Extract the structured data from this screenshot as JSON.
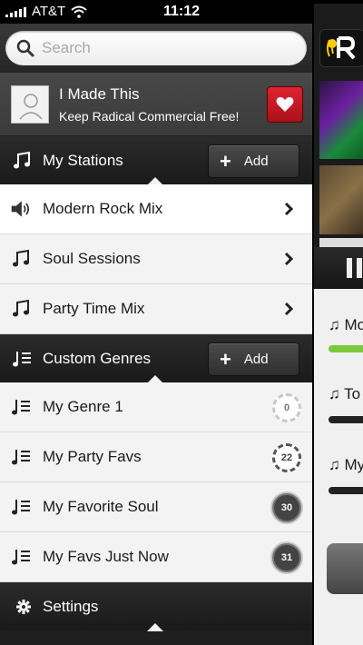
{
  "status_bar": {
    "carrier": "AT&T",
    "time": "11:12"
  },
  "search": {
    "placeholder": "Search"
  },
  "promo": {
    "title": "I Made This",
    "subtitle": "Keep Radical Commercial Free!"
  },
  "my_stations": {
    "title": "My Stations",
    "add_label": "Add",
    "items": [
      {
        "label": "Modern Rock Mix",
        "icon": "speaker-icon",
        "active": true
      },
      {
        "label": "Soul Sessions",
        "icon": "music-note-icon"
      },
      {
        "label": "Party Time Mix",
        "icon": "music-note-icon"
      }
    ]
  },
  "custom_genres": {
    "title": "Custom Genres",
    "add_label": "Add",
    "items": [
      {
        "label": "My Genre 1",
        "count": "0"
      },
      {
        "label": "My Party Favs",
        "count": "22"
      },
      {
        "label": "My Favorite Soul",
        "count": "30"
      },
      {
        "label": "My Favs Just Now",
        "count": "31"
      }
    ]
  },
  "settings": {
    "label": "Settings"
  },
  "right_panel": {
    "items": [
      {
        "label": "Mo"
      },
      {
        "label": "To"
      },
      {
        "label": "My"
      }
    ]
  },
  "colors": {
    "accent_red": "#d2202c",
    "progress_green": "#7ac93a"
  }
}
